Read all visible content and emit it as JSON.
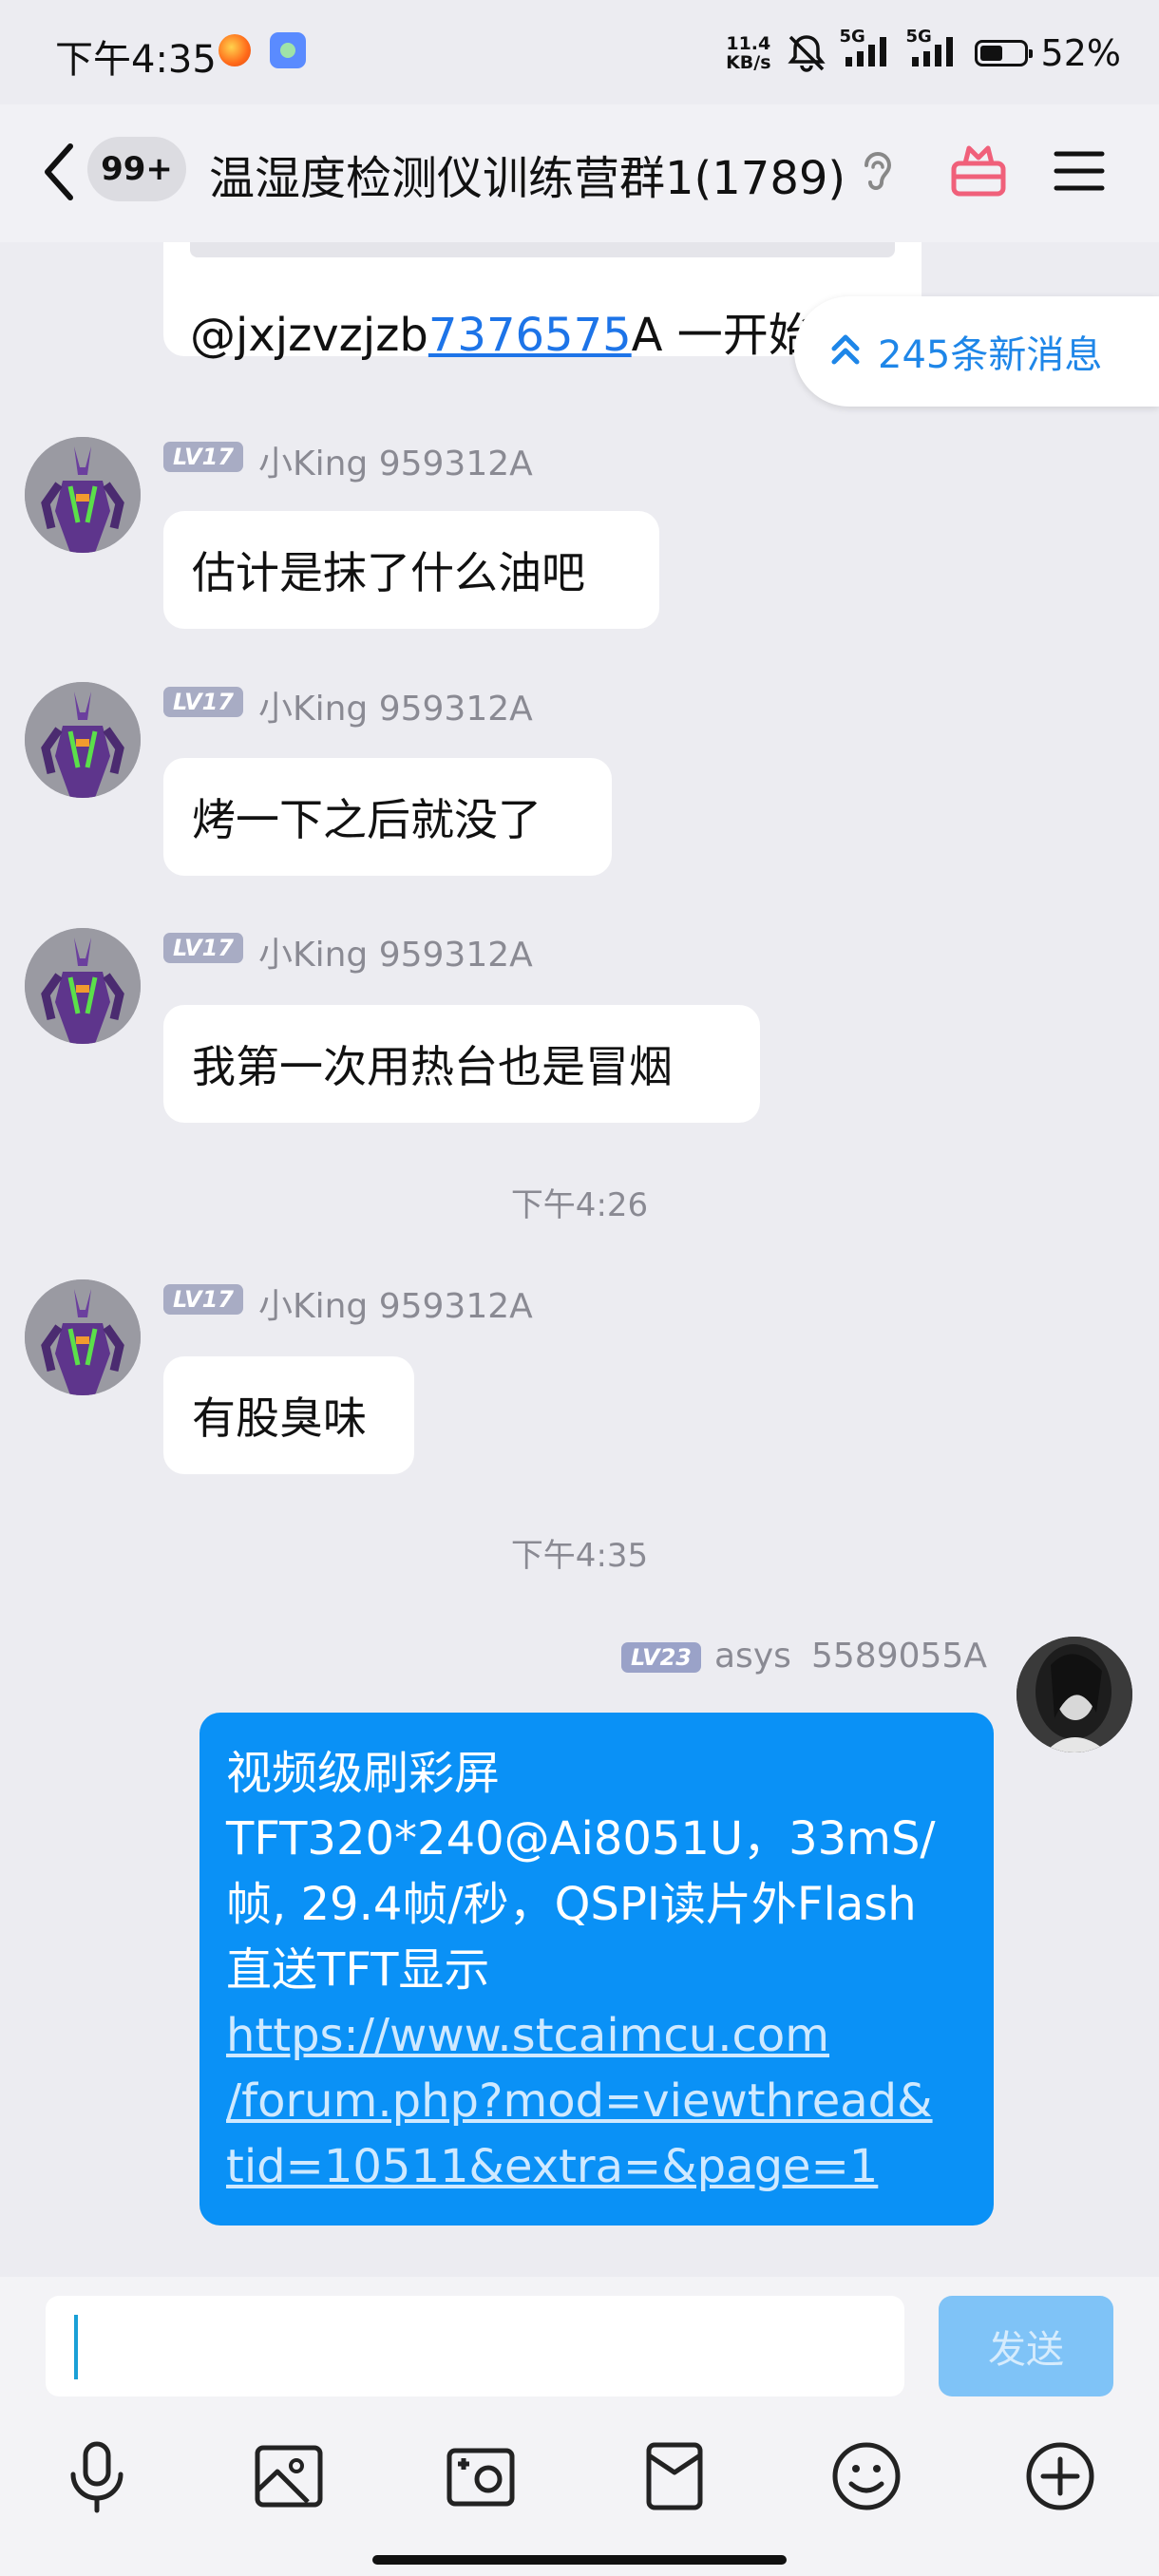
{
  "status_bar": {
    "time": "下午4:35",
    "net_speed_value": "11.4",
    "net_speed_unit": "KB/s",
    "signal_1": "5G",
    "signal_2": "5G",
    "battery_percent": "52%",
    "battery_level": 0.52
  },
  "header": {
    "unread_badge": "99+",
    "title": "温湿度检测仪训练营群1(1789)"
  },
  "chat": {
    "partial_message_prefix": "@jxjzvzjzb",
    "partial_message_mention": "7376575",
    "partial_message_suffix": "A 一开始",
    "new_messages_label": "245条新消息",
    "messages": [
      {
        "level": "LV17",
        "sender": "小King 959312A",
        "text": "估计是抹了什么油吧"
      },
      {
        "level": "LV17",
        "sender": "小King 959312A",
        "text": "烤一下之后就没了"
      },
      {
        "level": "LV17",
        "sender": "小King 959312A",
        "text": "我第一次用热台也是冒烟"
      },
      {
        "level": "LV17",
        "sender": "小King 959312A",
        "text": "有股臭味"
      }
    ],
    "time_separator_1": "下午4:26",
    "time_separator_2": "下午4:35",
    "self_message": {
      "level": "LV23",
      "sender_name": "asys",
      "sender_id": "5589055A",
      "line1": "视频级刷彩屏",
      "line2": "TFT320*240@Ai8051U，33mS/",
      "line3": "帧, 29.4帧/秒，QSPI读片外Flash",
      "line4": "直送TFT显示",
      "link": "https://www.stcaimcu.com/forum.php?mod=viewthread&tid=10511&extra=&page=1",
      "link_line1": "https://www.stcaimcu.com",
      "link_line2": "/forum.php?mod=viewthread&",
      "link_line3": "tid=10511&extra=&page=1"
    }
  },
  "input": {
    "value": "",
    "send_label": "发送"
  },
  "toolbar": {
    "icons": [
      "microphone-icon",
      "image-icon",
      "camera-icon",
      "red-packet-icon",
      "emoji-icon",
      "plus-icon"
    ]
  },
  "colors": {
    "accent_blue": "#0a91f6",
    "link_blue": "#1d74e8",
    "send_disabled": "#7fc3f7",
    "background": "#ececf1"
  }
}
